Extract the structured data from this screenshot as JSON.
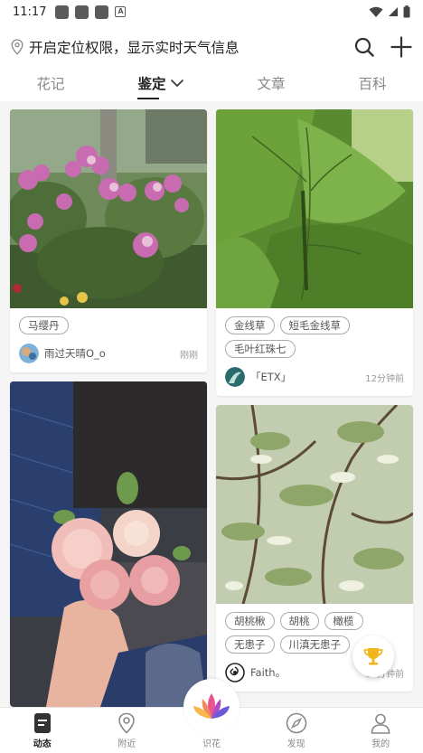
{
  "status_bar": {
    "time": "11:17",
    "mini_icon_letter": "A"
  },
  "header": {
    "location_text": "开启定位权限，显示实时天气信息"
  },
  "tabs": [
    {
      "label": "花记"
    },
    {
      "label": "鉴定"
    },
    {
      "label": "文章"
    },
    {
      "label": "百科"
    }
  ],
  "cards": {
    "left": [
      {
        "tags": [
          "马缨丹"
        ],
        "user": "雨过天晴O_o",
        "time": "刚刚"
      },
      {
        "tags": [],
        "user": "",
        "time": ""
      }
    ],
    "right": [
      {
        "tags": [
          "金线草",
          "短毛金线草",
          "毛叶红珠七"
        ],
        "user": "「ETX」",
        "time": "12分钟前"
      },
      {
        "tags": [
          "胡桃楸",
          "胡桃",
          "橄榄",
          "无患子",
          "川滇无患子"
        ],
        "user": "Faith。",
        "time": "15分钟前"
      }
    ]
  },
  "bottom_nav": [
    {
      "label": "动态"
    },
    {
      "label": "附近"
    },
    {
      "label": "识花"
    },
    {
      "label": "发现"
    },
    {
      "label": "我的"
    }
  ]
}
